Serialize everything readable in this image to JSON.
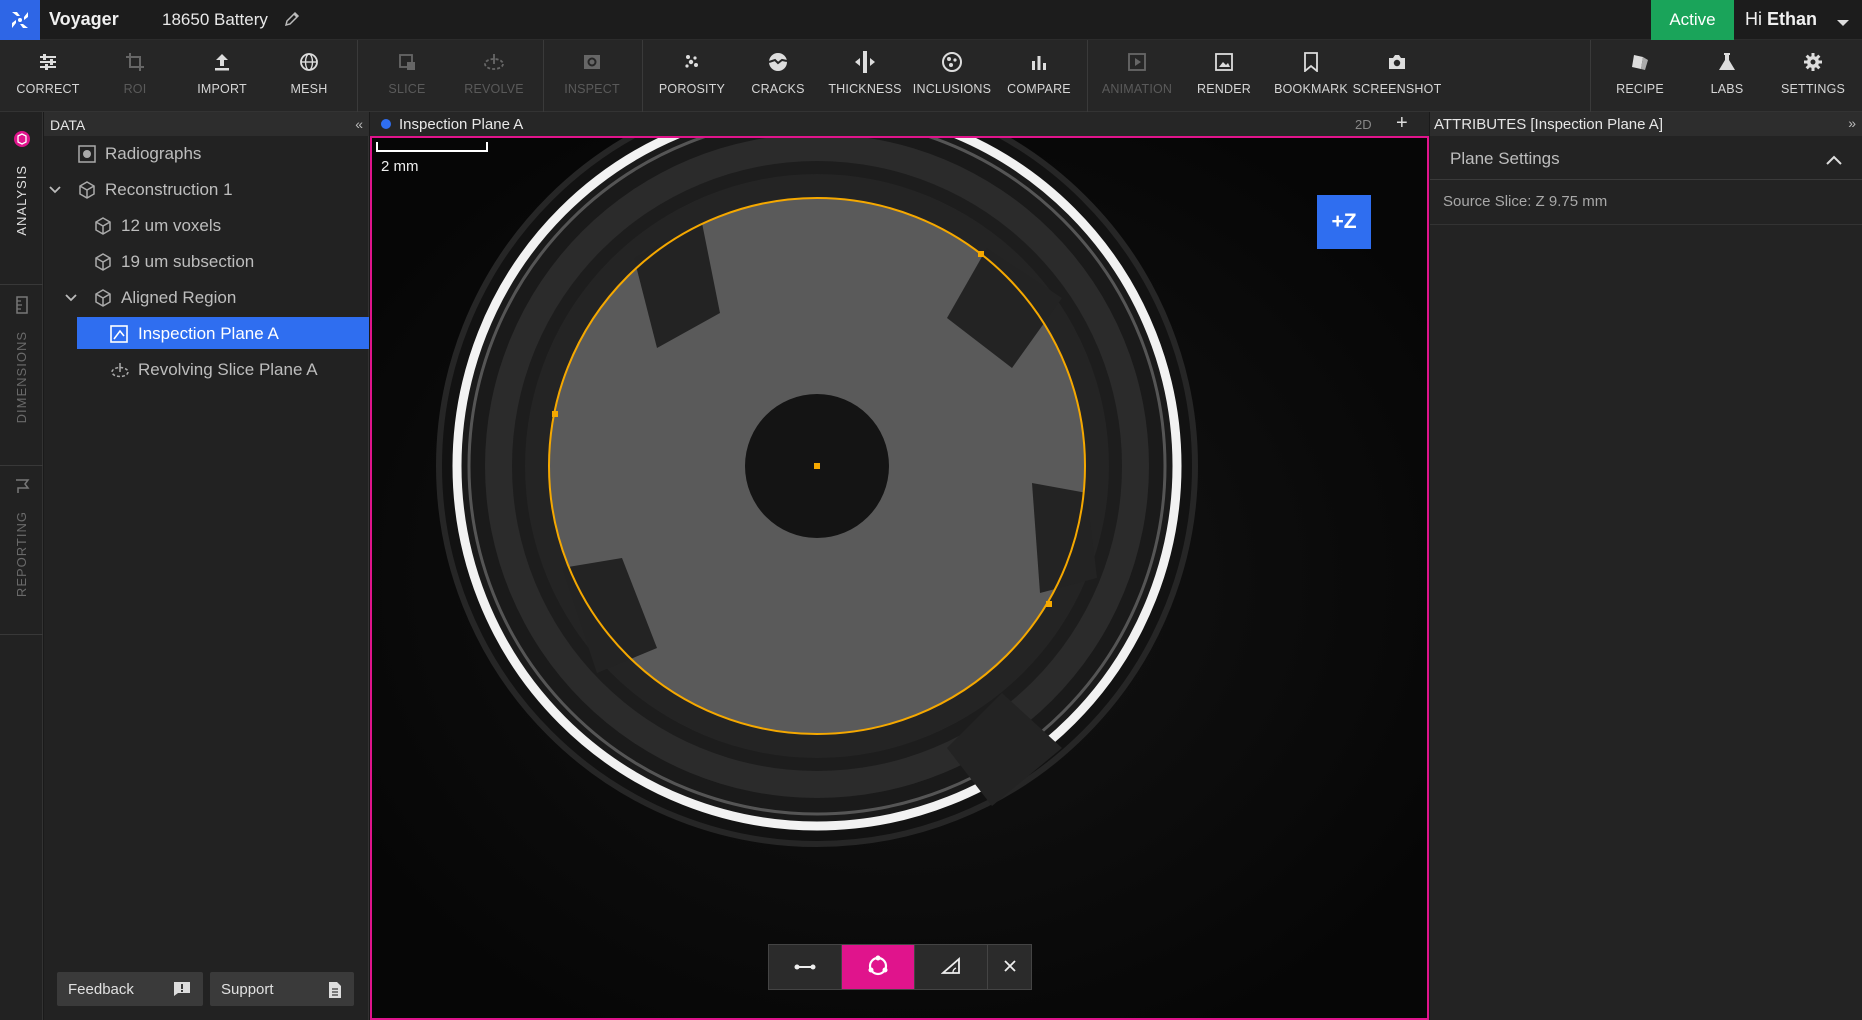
{
  "app": {
    "name": "Voyager",
    "project": "18650 Battery"
  },
  "status": {
    "label": "Active",
    "color": "#1aa45a"
  },
  "user": {
    "greeting": "Hi",
    "name": "Ethan"
  },
  "toolbar": {
    "correct": "CORRECT",
    "roi": "ROI",
    "import": "IMPORT",
    "mesh": "MESH",
    "slice": "SLICE",
    "revolve": "REVOLVE",
    "inspect": "INSPECT",
    "porosity": "POROSITY",
    "cracks": "CRACKS",
    "thickness": "THICKNESS",
    "inclusions": "INCLUSIONS",
    "compare": "COMPARE",
    "animation": "ANIMATION",
    "render": "RENDER",
    "bookmark": "BOOKMARK",
    "screenshot": "SCREENSHOT",
    "recipe": "RECIPE",
    "labs": "LABS",
    "settings": "SETTINGS"
  },
  "rail": {
    "analysis": "ANALYSIS",
    "dimensions": "DIMENSIONS",
    "reporting": "REPORTING"
  },
  "data_panel": {
    "title": "DATA",
    "items": [
      {
        "label": "Radiographs",
        "icon": "radiograph-icon"
      },
      {
        "label": "Reconstruction 1",
        "icon": "cube-icon"
      },
      {
        "label": "12 um voxels",
        "icon": "cube-icon"
      },
      {
        "label": "19 um subsection",
        "icon": "cube-icon"
      },
      {
        "label": "Aligned Region",
        "icon": "cube-icon"
      },
      {
        "label": "Inspection Plane A",
        "icon": "plane-icon"
      },
      {
        "label": "Revolving Slice Plane A",
        "icon": "revolve-icon"
      }
    ],
    "feedback": "Feedback",
    "support": "Support"
  },
  "viewport": {
    "title": "Inspection Plane A",
    "mode": "2D",
    "scale": "2 mm",
    "orientation": "+Z",
    "accent": "#e0148c",
    "tools": [
      "line-measure-icon",
      "circle-measure-icon",
      "angle-measure-icon",
      "close-icon"
    ]
  },
  "attributes": {
    "title": "ATTRIBUTES [Inspection Plane A]",
    "section": "Plane Settings",
    "source_slice": "Source Slice: Z 9.75 mm"
  }
}
